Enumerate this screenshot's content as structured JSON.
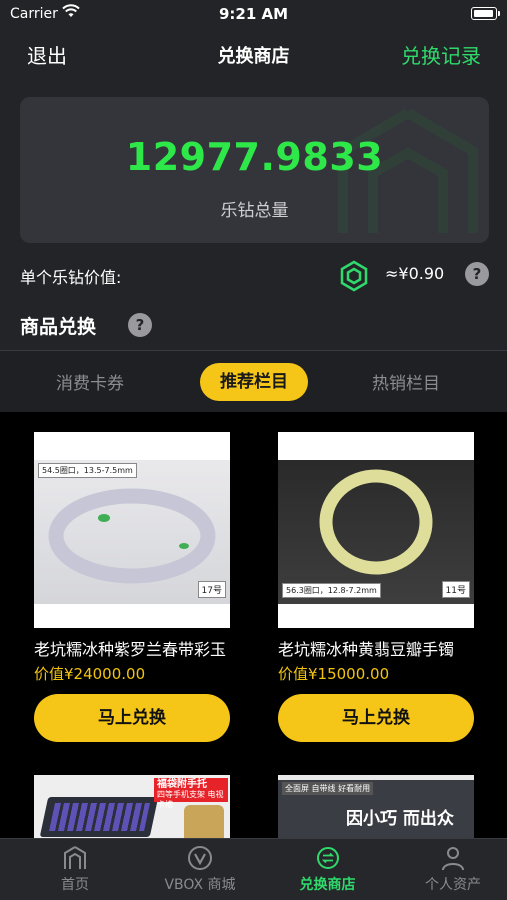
{
  "status_bar": {
    "carrier": "Carrier",
    "time": "9:21 AM"
  },
  "nav": {
    "back": "退出",
    "title": "兑换商店",
    "record": "兑换记录"
  },
  "balance": {
    "amount": "12977.9833",
    "label": "乐钻总量"
  },
  "unit_value": {
    "label": "单个乐钻价值:",
    "value": "≈¥0.90"
  },
  "section": {
    "title": "商品兑换"
  },
  "tabs": [
    {
      "label": "消费卡券",
      "active": false
    },
    {
      "label": "推荐栏目",
      "active": true
    },
    {
      "label": "热销栏目",
      "active": false
    }
  ],
  "products": [
    {
      "name": "老坑糯冰种紫罗兰春带彩玉",
      "price": "价值¥24000.00",
      "button": "马上兑换",
      "tag_spec": "54.5圈口，13.5-7.5mm",
      "tag_no": "17号"
    },
    {
      "name": "老坑糯冰种黄翡豆瓣手镯",
      "price": "价值¥15000.00",
      "button": "马上兑换",
      "tag_spec": "56.3圈口，12.8-7.2mm",
      "tag_no": "11号"
    }
  ],
  "thumbs": {
    "left_promo": "福袋附手托",
    "left_promo_sub": "四等手机支架 电视 卡槽",
    "right_badge": "全面屏 自带线 好看耐用",
    "right_slogan": "因小巧 而出众"
  },
  "tabbar": [
    {
      "label": "首页",
      "icon": "home-icon",
      "active": false
    },
    {
      "label": "VBOX 商城",
      "icon": "vbox-icon",
      "active": false
    },
    {
      "label": "兑换商店",
      "icon": "exchange-icon",
      "active": true
    },
    {
      "label": "个人资产",
      "icon": "person-icon",
      "active": false
    }
  ],
  "colors": {
    "accent_green": "#2fd96b",
    "amount_green": "#2ee84a",
    "accent_yellow": "#f5c518"
  }
}
